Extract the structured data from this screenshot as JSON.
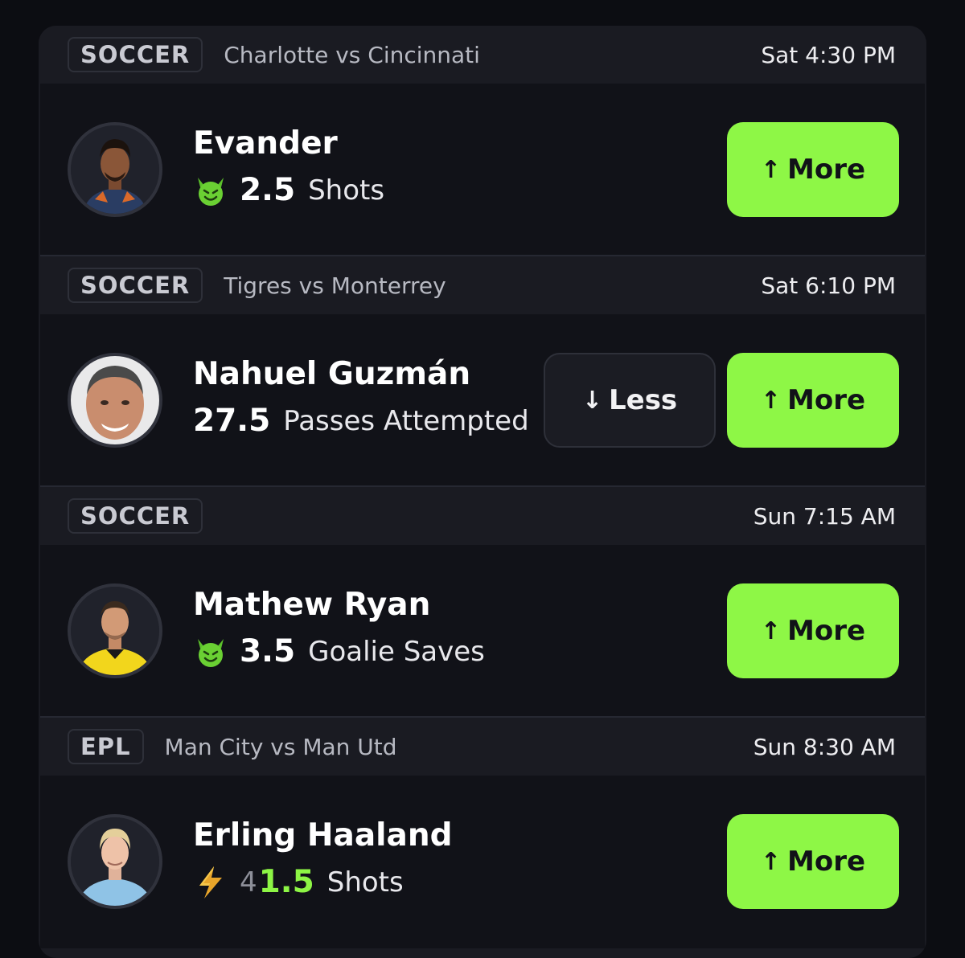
{
  "cards": [
    {
      "league": "SOCCER",
      "matchup": "Charlotte vs Cincinnati",
      "time": "Sat 4:30 PM",
      "player": "Evander",
      "badge_icon": "devil-icon",
      "line": "2.5",
      "stat": "Shots",
      "more_label": "More"
    },
    {
      "league": "SOCCER",
      "matchup": "Tigres vs Monterrey",
      "time": "Sat 6:10 PM",
      "player": "Nahuel Guzmán",
      "line": "27.5",
      "stat": "Passes Attempted",
      "less_label": "Less",
      "more_label": "More"
    },
    {
      "league": "SOCCER",
      "matchup": "",
      "time": "Sun 7:15 AM",
      "player": "Mathew Ryan",
      "badge_icon": "devil-icon",
      "line": "3.5",
      "stat": "Goalie Saves",
      "more_label": "More"
    },
    {
      "league": "EPL",
      "matchup": "Man City vs Man Utd",
      "time": "Sun 8:30 AM",
      "player": "Erling Haaland",
      "badge_icon": "lightning-icon",
      "old_line": "4",
      "line": "1.5",
      "stat": "Shots",
      "more_label": "More"
    }
  ],
  "colors": {
    "accent": "#8ef746",
    "background": "#0c0d12",
    "card": "#111218",
    "header": "#1a1b22"
  }
}
